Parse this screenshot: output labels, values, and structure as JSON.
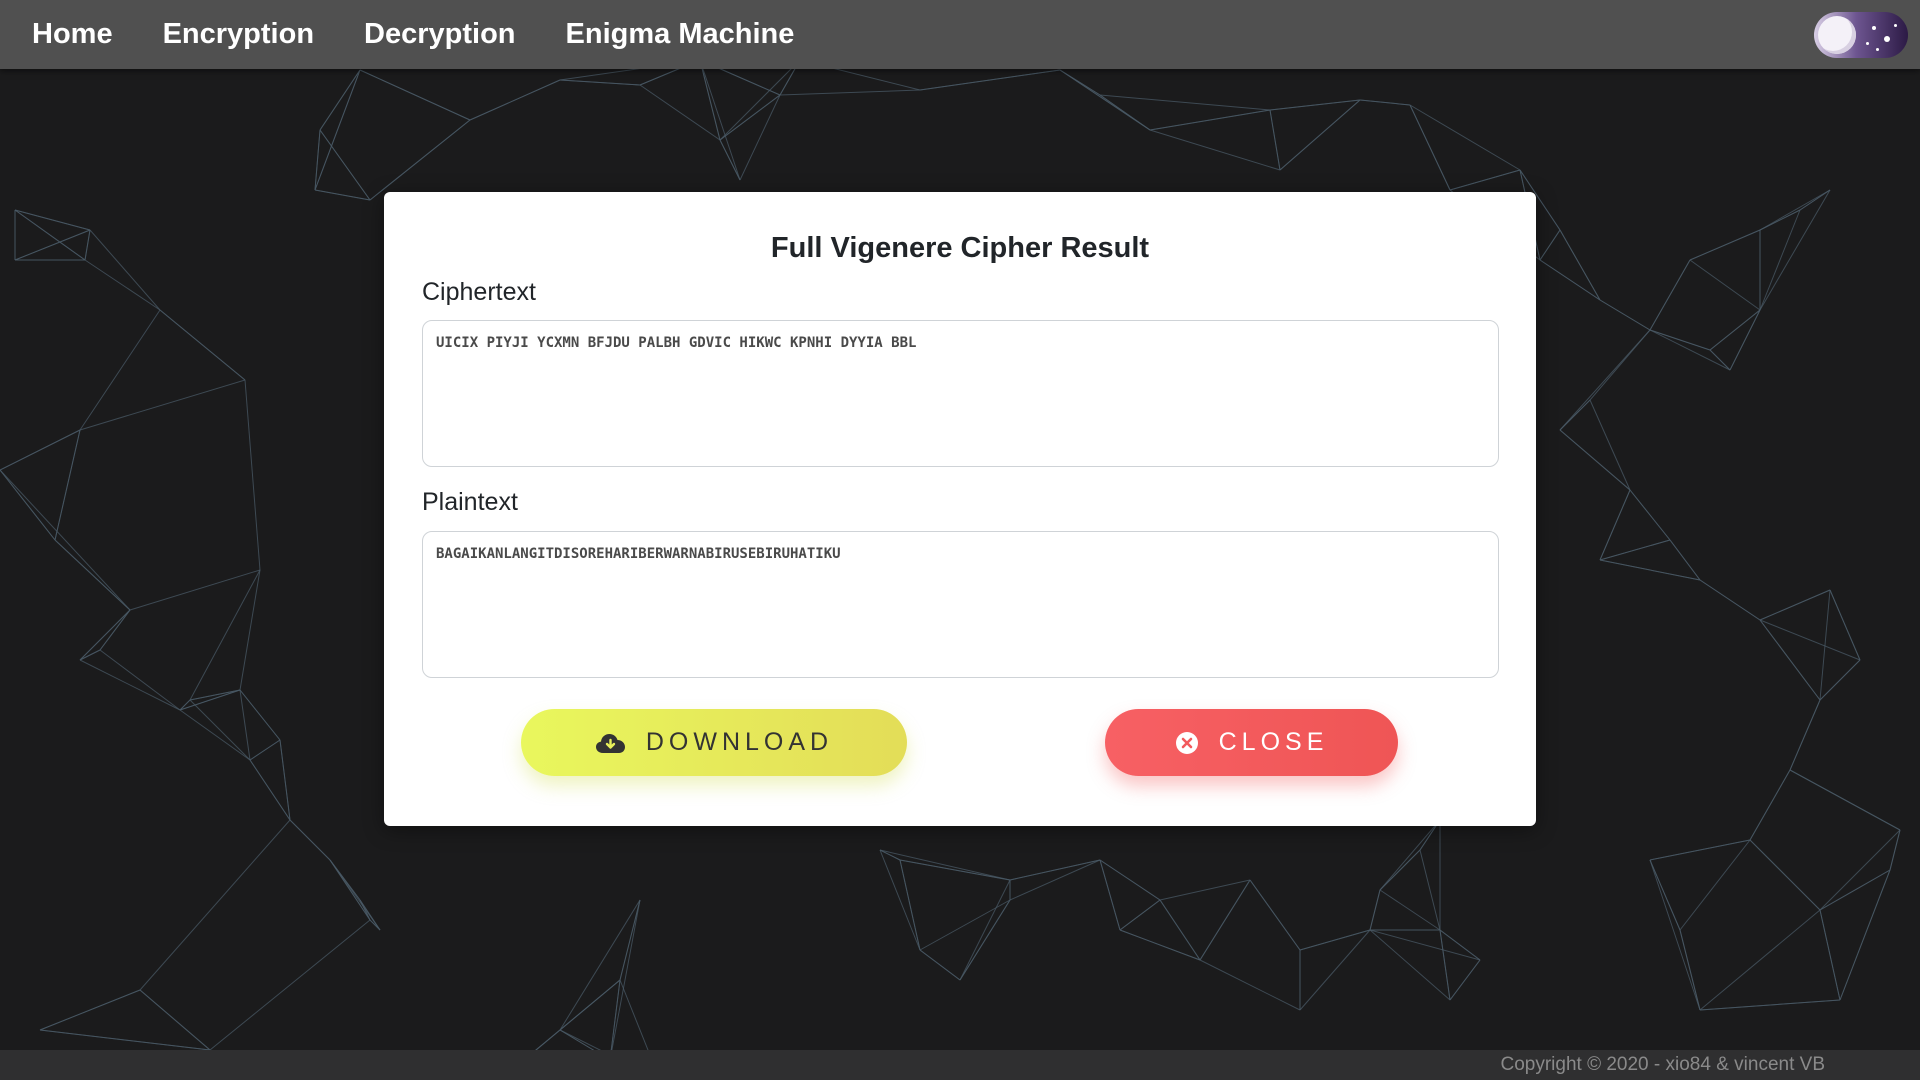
{
  "navbar": {
    "items": [
      {
        "label": "Home"
      },
      {
        "label": "Encryption"
      },
      {
        "label": "Decryption"
      },
      {
        "label": "Enigma Machine"
      }
    ]
  },
  "modal": {
    "title": "Full Vigenere Cipher Result",
    "ciphertext_label": "Ciphertext",
    "ciphertext_value": "UICIX PIYJI YCXMN BFJDU PALBH GDVIC HIKWC KPNHI DYYIA BBL",
    "plaintext_label": "Plaintext",
    "plaintext_value": "BAGAIKANLANGITDISOREHARIBERWARNABIRUSEBIRUHATIKU",
    "download_label": "DOWNLOAD",
    "close_label": "CLOSE"
  },
  "footer": {
    "copyright": "Copyright © 2020 - xio84 & vincent VB"
  },
  "colors": {
    "navbar_bg": "#505050",
    "page_bg": "#1b1b1c",
    "download_button": "#e6ee5a",
    "close_button": "#f45c5f"
  },
  "icons": {
    "download": "cloud-download-icon",
    "close": "close-circle-icon",
    "theme_toggle": "moon-icon"
  }
}
